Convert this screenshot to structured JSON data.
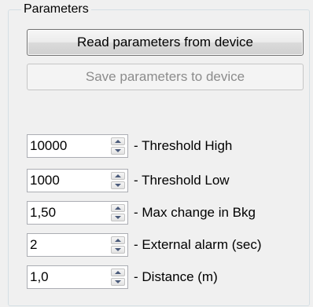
{
  "group": {
    "title": "Parameters"
  },
  "buttons": {
    "read_label": "Read parameters from device",
    "save_label": "Save parameters to device"
  },
  "fields": [
    {
      "value": "10000",
      "label": "- Threshold High"
    },
    {
      "value": "1000",
      "label": "- Threshold Low"
    },
    {
      "value": "1,50",
      "label": "- Max change in Bkg"
    },
    {
      "value": "2",
      "label": "- External alarm (sec)"
    },
    {
      "value": "1,0",
      "label": "- Distance (m)"
    }
  ]
}
